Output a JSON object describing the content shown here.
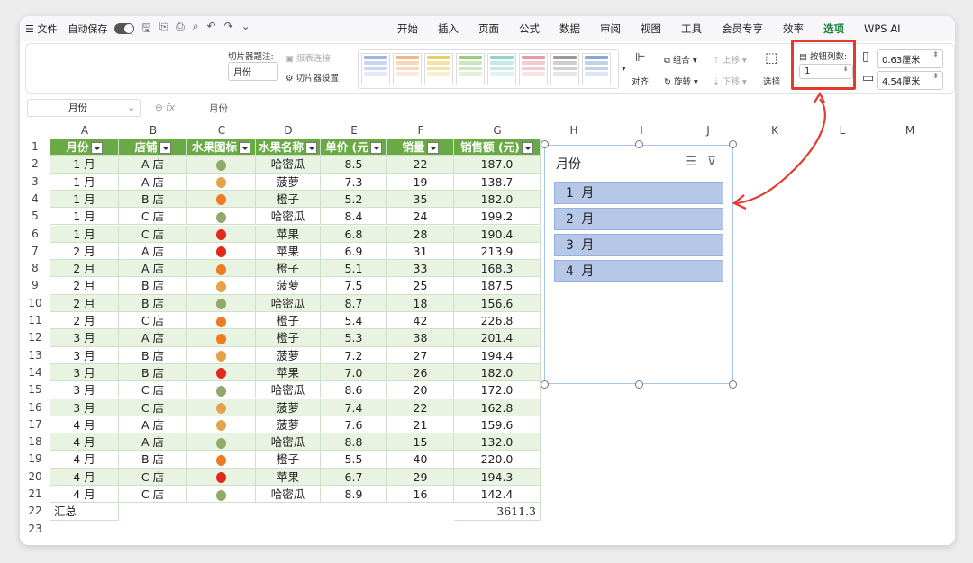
{
  "menubar": {
    "menu_label": "☰ 文件",
    "autosave_label": "自动保存",
    "tabs": [
      "开始",
      "插入",
      "页面",
      "公式",
      "数据",
      "审阅",
      "视图",
      "工具",
      "会员专享",
      "效率",
      "选项",
      "WPS AI"
    ],
    "active_tab": "选项"
  },
  "ribbon": {
    "slicer_caption_label": "切片器题注:",
    "slicer_caption_value": "月份",
    "report_connection": "报表连接",
    "slicer_settings": "切片器设置",
    "align": "对齐",
    "group": "组合",
    "rotate": "旋转",
    "bring_forward": "上移",
    "send_backward": "下移",
    "select": "选择",
    "columns_label": "按钮列数:",
    "columns_value": "1",
    "width_value": "0.63厘米",
    "height_value": "4.54厘米"
  },
  "formula_bar": {
    "name_box": "月份",
    "fx": "fx",
    "content": "月份"
  },
  "columns": [
    "A",
    "B",
    "C",
    "D",
    "E",
    "F",
    "G",
    "H",
    "I",
    "J",
    "K",
    "L",
    "M"
  ],
  "headers": [
    "月份",
    "店铺",
    "水果图标",
    "水果名称",
    "单价 (元",
    "销量",
    "销售额 (元)"
  ],
  "rows": [
    [
      "1 月",
      "A 店",
      "melon",
      "哈密瓜",
      "8.5",
      "22",
      "187.0"
    ],
    [
      "1 月",
      "A 店",
      "pineapple",
      "菠萝",
      "7.3",
      "19",
      "138.7"
    ],
    [
      "1 月",
      "B 店",
      "orange",
      "橙子",
      "5.2",
      "35",
      "182.0"
    ],
    [
      "1 月",
      "C 店",
      "melon",
      "哈密瓜",
      "8.4",
      "24",
      "199.2"
    ],
    [
      "1 月",
      "C 店",
      "apple",
      "苹果",
      "6.8",
      "28",
      "190.4"
    ],
    [
      "2 月",
      "A 店",
      "apple",
      "苹果",
      "6.9",
      "31",
      "213.9"
    ],
    [
      "2 月",
      "A 店",
      "orange",
      "橙子",
      "5.1",
      "33",
      "168.3"
    ],
    [
      "2 月",
      "B 店",
      "pineapple",
      "菠萝",
      "7.5",
      "25",
      "187.5"
    ],
    [
      "2 月",
      "B 店",
      "melon",
      "哈密瓜",
      "8.7",
      "18",
      "156.6"
    ],
    [
      "2 月",
      "C 店",
      "orange",
      "橙子",
      "5.4",
      "42",
      "226.8"
    ],
    [
      "3 月",
      "A 店",
      "orange",
      "橙子",
      "5.3",
      "38",
      "201.4"
    ],
    [
      "3 月",
      "B 店",
      "pineapple",
      "菠萝",
      "7.2",
      "27",
      "194.4"
    ],
    [
      "3 月",
      "B 店",
      "apple",
      "苹果",
      "7.0",
      "26",
      "182.0"
    ],
    [
      "3 月",
      "C 店",
      "melon",
      "哈密瓜",
      "8.6",
      "20",
      "172.0"
    ],
    [
      "3 月",
      "C 店",
      "pineapple",
      "菠萝",
      "7.4",
      "22",
      "162.8"
    ],
    [
      "4 月",
      "A 店",
      "pineapple",
      "菠萝",
      "7.6",
      "21",
      "159.6"
    ],
    [
      "4 月",
      "A 店",
      "melon",
      "哈密瓜",
      "8.8",
      "15",
      "132.0"
    ],
    [
      "4 月",
      "B 店",
      "orange",
      "橙子",
      "5.5",
      "40",
      "220.0"
    ],
    [
      "4 月",
      "C 店",
      "apple",
      "苹果",
      "6.7",
      "29",
      "194.3"
    ],
    [
      "4 月",
      "C 店",
      "melon",
      "哈密瓜",
      "8.9",
      "16",
      "142.4"
    ]
  ],
  "total_label": "汇总",
  "total_value": "3611.3",
  "row_numbers": [
    "1",
    "2",
    "3",
    "4",
    "5",
    "6",
    "7",
    "8",
    "9",
    "10",
    "11",
    "12",
    "13",
    "14",
    "15",
    "16",
    "17",
    "18",
    "19",
    "20",
    "21",
    "22",
    "23"
  ],
  "slicer": {
    "title": "月份",
    "items": [
      "1 月",
      "2 月",
      "3 月",
      "4 月"
    ]
  },
  "colors": {
    "header_green": "#6aaa45",
    "band_green": "#e9f3e2",
    "slicer_item": "#b7c7e8",
    "highlight_red": "#e23b2e",
    "fruit_melon": "#8faa6a",
    "fruit_orange": "#f07a22",
    "fruit_pineapple": "#e6a24a",
    "fruit_apple": "#e02a1c"
  }
}
